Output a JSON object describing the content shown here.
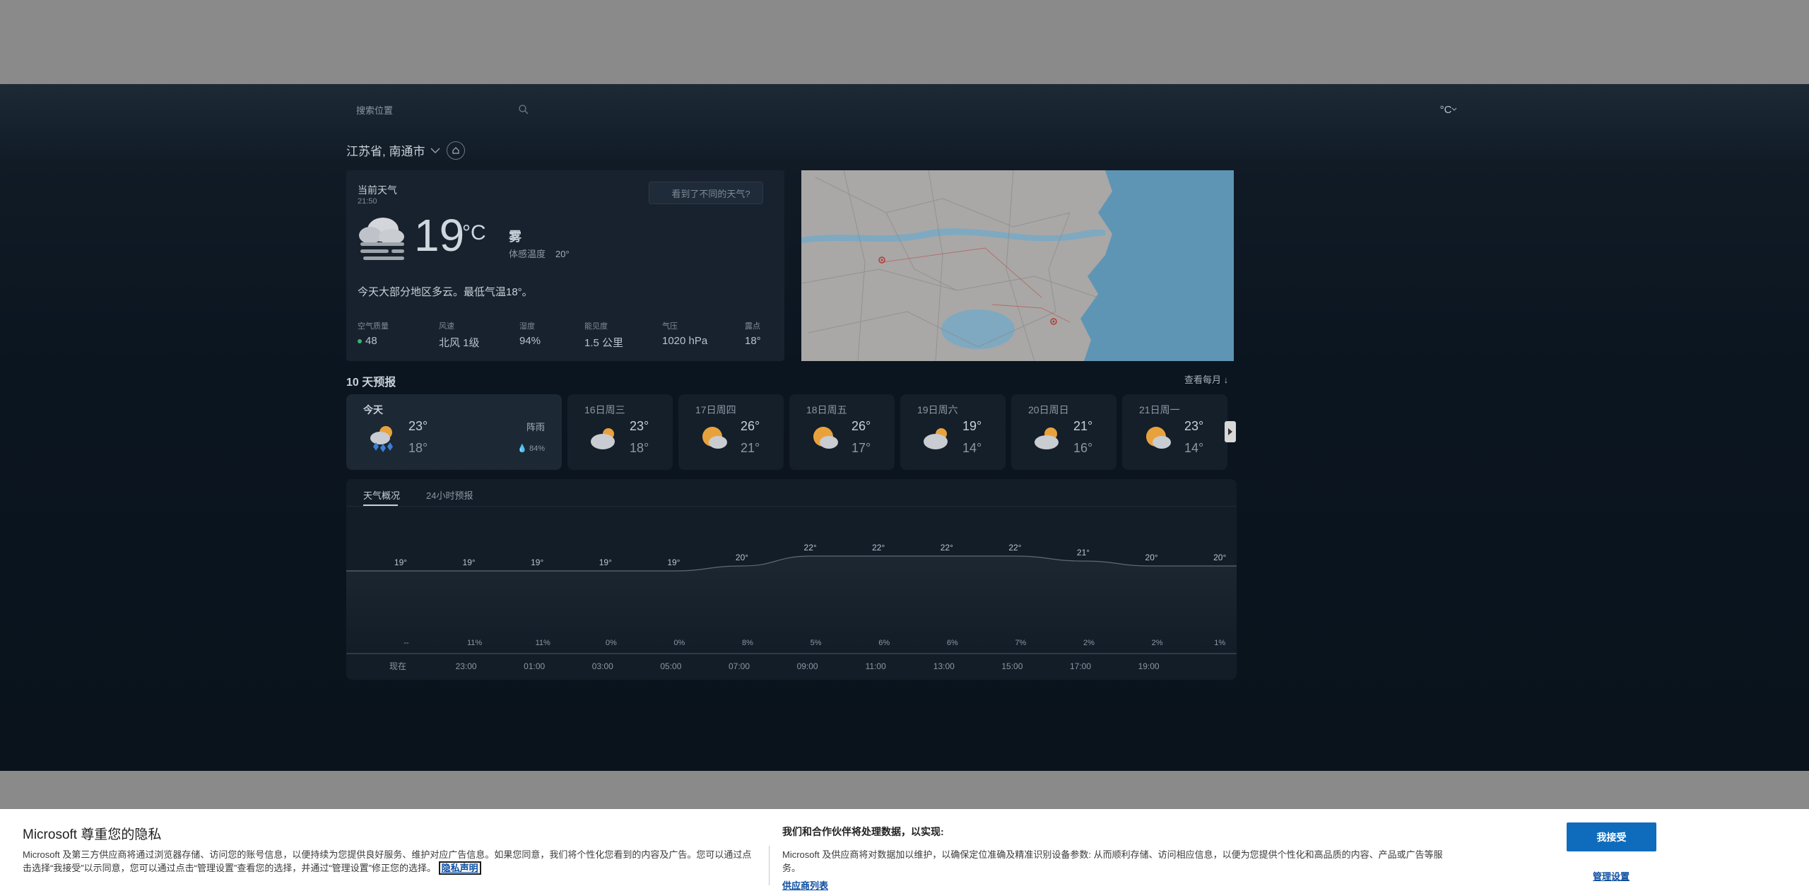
{
  "header": {
    "search_placeholder": "搜索位置",
    "unit": "°C"
  },
  "location": {
    "name": "江苏省, 南通市"
  },
  "current": {
    "title": "当前天气",
    "time": "21:50",
    "diff_button": "看到了不同的天气?",
    "temp": "19",
    "unit": "°C",
    "condition": "雾",
    "feels_label": "体感温度",
    "feels_value": "20°",
    "summary": "今天大部分地区多云。最低气温18°。",
    "metrics": [
      {
        "label": "空气质量",
        "value": "48"
      },
      {
        "label": "风速",
        "value": "北风 1级"
      },
      {
        "label": "湿度",
        "value": "94%"
      },
      {
        "label": "能见度",
        "value": "1.5 公里"
      },
      {
        "label": "气压",
        "value": "1020 hPa"
      },
      {
        "label": "露点",
        "value": "18°"
      }
    ]
  },
  "forecast": {
    "title": "10 天预报",
    "view_month": "查看每月 ↓",
    "days": [
      {
        "name": "今天",
        "hi": "23°",
        "lo": "18°",
        "rain": "阵雨",
        "precip": "84%",
        "icon": "rain-sun-icon"
      },
      {
        "name": "16日周三",
        "hi": "23°",
        "lo": "18°",
        "icon": "cloudy-icon"
      },
      {
        "name": "17日周四",
        "hi": "26°",
        "lo": "21°",
        "icon": "partly-sunny-icon"
      },
      {
        "name": "18日周五",
        "hi": "26°",
        "lo": "17°",
        "icon": "partly-sunny-icon"
      },
      {
        "name": "19日周六",
        "hi": "19°",
        "lo": "14°",
        "icon": "cloudy-icon"
      },
      {
        "name": "20日周日",
        "hi": "21°",
        "lo": "16°",
        "icon": "partly-cloudy-icon"
      },
      {
        "name": "21日周一",
        "hi": "23°",
        "lo": "14°",
        "icon": "partly-sunny-icon"
      }
    ]
  },
  "hourly": {
    "tabs": [
      "天气概况",
      "24小时预报"
    ],
    "times": [
      "现在",
      "23:00",
      "01:00",
      "03:00",
      "05:00",
      "07:00",
      "09:00",
      "11:00",
      "13:00",
      "15:00",
      "17:00",
      "19:00",
      ""
    ]
  },
  "chart_data": {
    "type": "line",
    "x": [
      "现在",
      "23:00",
      "01:00",
      "03:00",
      "05:00",
      "07:00",
      "09:00",
      "11:00",
      "13:00",
      "15:00",
      "17:00",
      "19:00",
      ""
    ],
    "series": [
      {
        "values": [
          19,
          19,
          19,
          19,
          19,
          20,
          22,
          22,
          22,
          22,
          21,
          20,
          20
        ],
        "labels": [
          "19°",
          "19°",
          "19°",
          "19°",
          "19°",
          "20°",
          "22°",
          "22°",
          "22°",
          "22°",
          "21°",
          "20°",
          "20°"
        ]
      },
      {
        "values": [
          null,
          11,
          11,
          0,
          0,
          8,
          5,
          6,
          6,
          7,
          2,
          2,
          1
        ],
        "labels": [
          "--",
          "11%",
          "11%",
          "0%",
          "0%",
          "8%",
          "5%",
          "6%",
          "6%",
          "7%",
          "2%",
          "2%",
          "1%"
        ]
      }
    ]
  },
  "privacy": {
    "title": "Microsoft 尊重您的隐私",
    "text": "Microsoft 及第三方供应商将通过浏览器存储、访问您的账号信息，以便持续为您提供良好服务、维护对应广告信息。如果您同意，我们将个性化您看到的内容及广告。您可以通过点击选择“我接受”以示同意，您可以通过点击“管理设置”查看您的选择，并通过“管理设置”修正您的选择。",
    "link": "隐私声明",
    "heading2": "我们和合作伙伴将处理数据，以实现:",
    "text2": "Microsoft 及供应商将对数据加以维护，以确保定位准确及精准识别设备参数: 从而顺利存储、访问相应信息，以便为您提供个性化和高品质的内容、产品或广告等服务。",
    "vendor_link": "供应商列表",
    "accept": "我接受",
    "manage": "管理设置"
  },
  "colors": {
    "app_bg": "#0b1520",
    "card_bg": "#17222e",
    "accent_blue": "#0f6cbd",
    "aqi_green": "#3bb273"
  }
}
